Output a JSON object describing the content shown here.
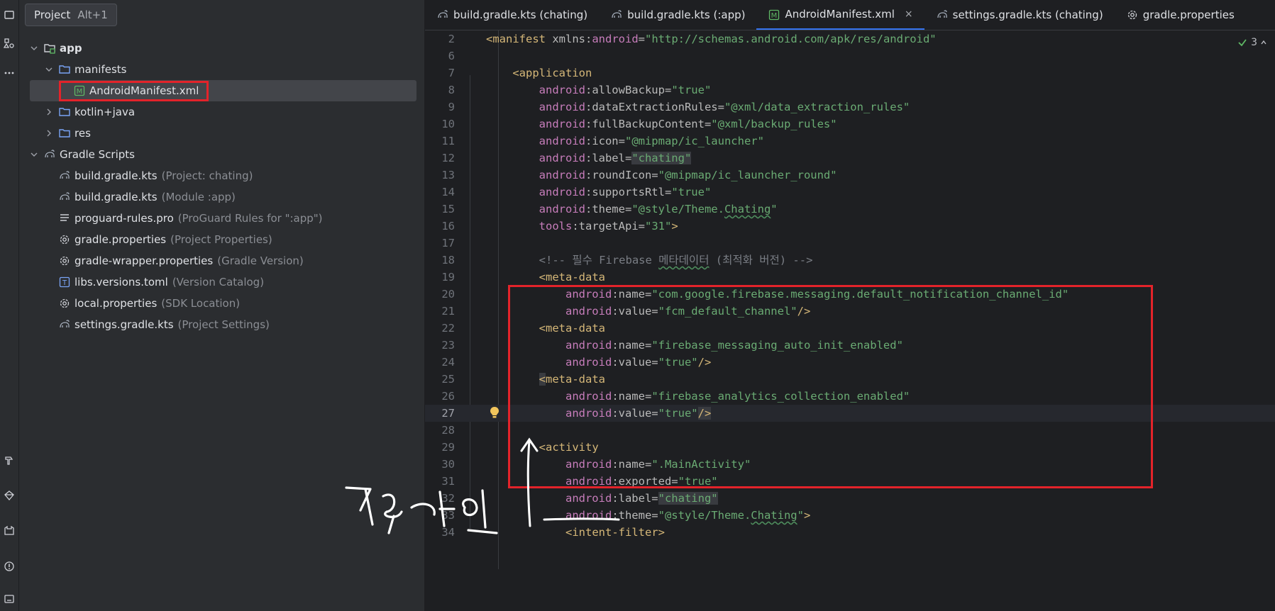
{
  "tooltip": {
    "label": "Project",
    "shortcut": "Alt+1"
  },
  "tree": [
    {
      "indent": 0,
      "chevron": "down",
      "icon": "module-folder-icon",
      "label": "app",
      "bold": true,
      "hint": ""
    },
    {
      "indent": 1,
      "chevron": "down",
      "icon": "folder-icon",
      "label": "manifests",
      "hint": ""
    },
    {
      "indent": 2,
      "chevron": "",
      "icon": "manifest-file-icon",
      "label": "AndroidManifest.xml",
      "hint": "",
      "selected": true
    },
    {
      "indent": 1,
      "chevron": "right",
      "icon": "folder-icon",
      "label": "kotlin+java",
      "hint": ""
    },
    {
      "indent": 1,
      "chevron": "right",
      "icon": "folder-icon",
      "label": "res",
      "hint": ""
    },
    {
      "indent": 0,
      "chevron": "down",
      "icon": "gradle-icon",
      "label": "Gradle Scripts",
      "hint": ""
    },
    {
      "indent": 1,
      "chevron": "",
      "icon": "gradle-icon",
      "label": "build.gradle.kts",
      "hint": "(Project: chating)"
    },
    {
      "indent": 1,
      "chevron": "",
      "icon": "gradle-icon",
      "label": "build.gradle.kts",
      "hint": "(Module :app)"
    },
    {
      "indent": 1,
      "chevron": "",
      "icon": "text-file-icon",
      "label": "proguard-rules.pro",
      "hint": "(ProGuard Rules for \":app\")"
    },
    {
      "indent": 1,
      "chevron": "",
      "icon": "settings-gear-icon",
      "label": "gradle.properties",
      "hint": "(Project Properties)"
    },
    {
      "indent": 1,
      "chevron": "",
      "icon": "settings-gear-icon",
      "label": "gradle-wrapper.properties",
      "hint": "(Gradle Version)"
    },
    {
      "indent": 1,
      "chevron": "",
      "icon": "toml-file-icon",
      "label": "libs.versions.toml",
      "hint": "(Version Catalog)"
    },
    {
      "indent": 1,
      "chevron": "",
      "icon": "settings-gear-icon",
      "label": "local.properties",
      "hint": "(SDK Location)"
    },
    {
      "indent": 1,
      "chevron": "",
      "icon": "gradle-icon",
      "label": "settings.gradle.kts",
      "hint": "(Project Settings)"
    }
  ],
  "tabs": [
    {
      "label": "build.gradle.kts (chating)",
      "icon": "gradle-icon",
      "active": false
    },
    {
      "label": "build.gradle.kts (:app)",
      "icon": "gradle-icon",
      "active": false
    },
    {
      "label": "AndroidManifest.xml",
      "icon": "manifest-file-icon",
      "active": true,
      "close": "×"
    },
    {
      "label": "settings.gradle.kts (chating)",
      "icon": "gradle-icon",
      "active": false
    },
    {
      "label": "gradle.properties",
      "icon": "settings-gear-icon",
      "active": false
    }
  ],
  "inspections": {
    "count": "3",
    "icon": "check-icon"
  },
  "code_lines": [
    {
      "n": "2",
      "segs": [
        [
          "punct",
          "<"
        ],
        [
          "tag",
          "manifest "
        ],
        [
          "attr",
          "xmlns:"
        ],
        [
          "ns",
          "android"
        ],
        [
          "attr",
          "="
        ],
        [
          "val",
          "\"http://schemas.android.com/apk/res/android\""
        ]
      ]
    },
    {
      "n": "6",
      "segs": []
    },
    {
      "n": "7",
      "segs": [
        [
          "plain",
          "    "
        ],
        [
          "punct",
          "<"
        ],
        [
          "tag",
          "application"
        ]
      ]
    },
    {
      "n": "8",
      "segs": [
        [
          "plain",
          "        "
        ],
        [
          "ns",
          "android"
        ],
        [
          "attr",
          ":allowBackup="
        ],
        [
          "val",
          "\"true\""
        ]
      ]
    },
    {
      "n": "9",
      "segs": [
        [
          "plain",
          "        "
        ],
        [
          "ns",
          "android"
        ],
        [
          "attr",
          ":dataExtractionRules="
        ],
        [
          "val",
          "\"@xml/data_extraction_rules\""
        ]
      ]
    },
    {
      "n": "10",
      "segs": [
        [
          "plain",
          "        "
        ],
        [
          "ns",
          "android"
        ],
        [
          "attr",
          ":fullBackupContent="
        ],
        [
          "val",
          "\"@xml/backup_rules\""
        ]
      ]
    },
    {
      "n": "11",
      "segs": [
        [
          "plain",
          "        "
        ],
        [
          "ns",
          "android"
        ],
        [
          "attr",
          ":icon="
        ],
        [
          "val",
          "\"@mipmap/ic_launcher\""
        ]
      ]
    },
    {
      "n": "12",
      "segs": [
        [
          "plain",
          "        "
        ],
        [
          "ns",
          "android"
        ],
        [
          "attr",
          ":label="
        ],
        [
          "val hl",
          "\"chating\""
        ]
      ]
    },
    {
      "n": "13",
      "segs": [
        [
          "plain",
          "        "
        ],
        [
          "ns",
          "android"
        ],
        [
          "attr",
          ":roundIcon="
        ],
        [
          "val",
          "\"@mipmap/ic_launcher_round\""
        ]
      ]
    },
    {
      "n": "14",
      "segs": [
        [
          "plain",
          "        "
        ],
        [
          "ns",
          "android"
        ],
        [
          "attr",
          ":supportsRtl="
        ],
        [
          "val",
          "\"true\""
        ]
      ]
    },
    {
      "n": "15",
      "segs": [
        [
          "plain",
          "        "
        ],
        [
          "ns",
          "android"
        ],
        [
          "attr",
          ":theme="
        ],
        [
          "val",
          "\"@style/Theme."
        ],
        [
          "val squiggle",
          "Chating"
        ],
        [
          "val",
          "\""
        ]
      ]
    },
    {
      "n": "16",
      "segs": [
        [
          "plain",
          "        "
        ],
        [
          "ns",
          "tools"
        ],
        [
          "attr",
          ":targetApi="
        ],
        [
          "val",
          "\"31\""
        ],
        [
          "punct",
          ">"
        ]
      ]
    },
    {
      "n": "17",
      "segs": []
    },
    {
      "n": "18",
      "segs": [
        [
          "plain",
          "        "
        ],
        [
          "comment",
          "<!-- 필수 Firebase "
        ],
        [
          "comment squiggle",
          "메타데이터"
        ],
        [
          "comment",
          " (최적화 버전) -->"
        ]
      ]
    },
    {
      "n": "19",
      "segs": [
        [
          "plain",
          "        "
        ],
        [
          "punct",
          "<"
        ],
        [
          "tag",
          "meta-data"
        ]
      ]
    },
    {
      "n": "20",
      "segs": [
        [
          "plain",
          "            "
        ],
        [
          "ns",
          "android"
        ],
        [
          "attr",
          ":name="
        ],
        [
          "val",
          "\"com.google.firebase.messaging.default_notification_channel_id\""
        ]
      ]
    },
    {
      "n": "21",
      "segs": [
        [
          "plain",
          "            "
        ],
        [
          "ns",
          "android"
        ],
        [
          "attr",
          ":value="
        ],
        [
          "val",
          "\"fcm_default_channel\""
        ],
        [
          "punct",
          "/>"
        ]
      ]
    },
    {
      "n": "22",
      "segs": [
        [
          "plain",
          "        "
        ],
        [
          "punct",
          "<"
        ],
        [
          "tag",
          "meta-data"
        ]
      ]
    },
    {
      "n": "23",
      "segs": [
        [
          "plain",
          "            "
        ],
        [
          "ns",
          "android"
        ],
        [
          "attr",
          ":name="
        ],
        [
          "val",
          "\"firebase_messaging_auto_init_enabled\""
        ]
      ]
    },
    {
      "n": "24",
      "segs": [
        [
          "plain",
          "            "
        ],
        [
          "ns",
          "android"
        ],
        [
          "attr",
          ":value="
        ],
        [
          "val",
          "\"true\""
        ],
        [
          "punct",
          "/>"
        ]
      ]
    },
    {
      "n": "25",
      "segs": [
        [
          "plain",
          "        "
        ],
        [
          "punct hl",
          "<"
        ],
        [
          "tag",
          "meta-data"
        ]
      ]
    },
    {
      "n": "26",
      "segs": [
        [
          "plain",
          "            "
        ],
        [
          "ns",
          "android"
        ],
        [
          "attr",
          ":name="
        ],
        [
          "val",
          "\"firebase_analytics_collection_enabled\""
        ]
      ]
    },
    {
      "n": "27",
      "segs": [
        [
          "plain",
          "            "
        ],
        [
          "ns",
          "android"
        ],
        [
          "attr",
          ":value="
        ],
        [
          "val",
          "\"true\""
        ],
        [
          "punct hl",
          "/>"
        ]
      ],
      "current": true
    },
    {
      "n": "28",
      "segs": []
    },
    {
      "n": "29",
      "segs": [
        [
          "plain",
          "        "
        ],
        [
          "punct",
          "<"
        ],
        [
          "tag",
          "activity"
        ]
      ]
    },
    {
      "n": "30",
      "segs": [
        [
          "plain",
          "            "
        ],
        [
          "ns",
          "android"
        ],
        [
          "attr",
          ":name="
        ],
        [
          "val",
          "\".MainActivity\""
        ]
      ]
    },
    {
      "n": "31",
      "segs": [
        [
          "plain",
          "            "
        ],
        [
          "ns",
          "android"
        ],
        [
          "attr",
          ":exported="
        ],
        [
          "val",
          "\"true\""
        ]
      ]
    },
    {
      "n": "32",
      "segs": [
        [
          "plain",
          "            "
        ],
        [
          "ns",
          "android"
        ],
        [
          "attr",
          ":label="
        ],
        [
          "val hl",
          "\"chating\""
        ]
      ]
    },
    {
      "n": "33",
      "segs": [
        [
          "plain",
          "            "
        ],
        [
          "ns",
          "android"
        ],
        [
          "attr",
          ":theme="
        ],
        [
          "val",
          "\"@style/Theme."
        ],
        [
          "val squiggle",
          "Chating"
        ],
        [
          "val",
          "\""
        ],
        [
          "punct",
          ">"
        ]
      ]
    },
    {
      "n": "34",
      "segs": [
        [
          "plain",
          "            "
        ],
        [
          "punct",
          "<"
        ],
        [
          "tag",
          "intent-filter"
        ],
        [
          "punct",
          ">"
        ]
      ]
    }
  ],
  "colors": {
    "highlight_box": "#e3232a",
    "accent": "#3574f0"
  }
}
